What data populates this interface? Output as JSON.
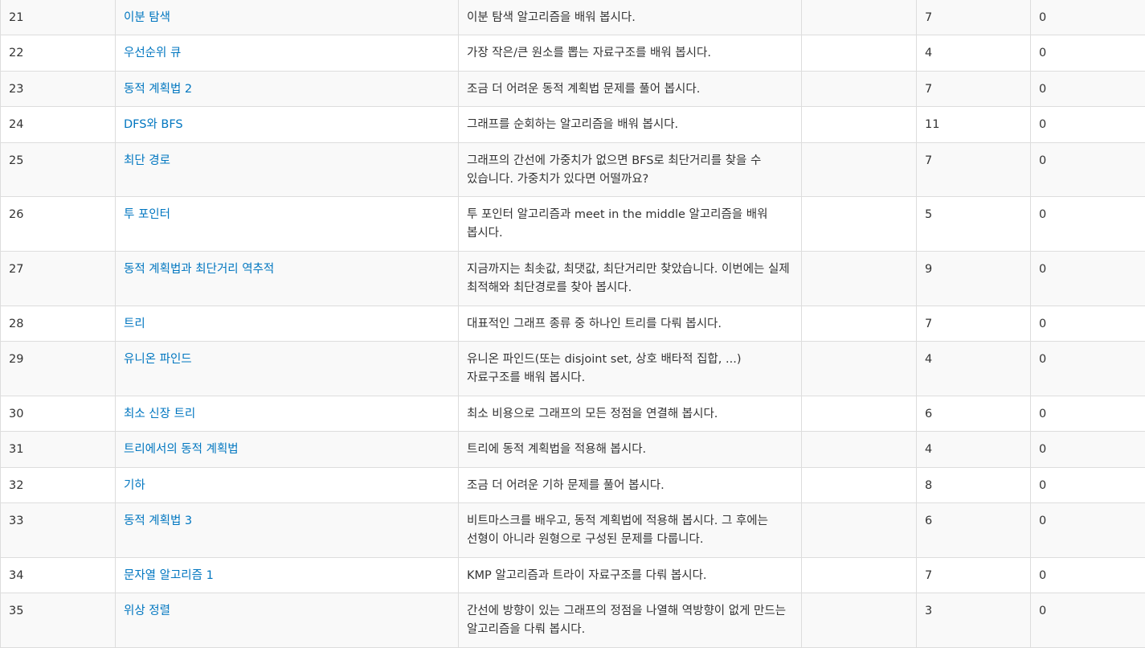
{
  "colors": {
    "link": "#0076c0",
    "text": "#333333",
    "border": "#dddddd",
    "stripe": "#f9f9f9"
  },
  "rows": [
    {
      "no": "21",
      "title": "이분 탐색",
      "desc": "이분 탐색 알고리즘을 배워 봅시다.",
      "extra": "",
      "problems": "7",
      "solved": "0"
    },
    {
      "no": "22",
      "title": "우선순위 큐",
      "desc": "가장 작은/큰 원소를 뽑는 자료구조를 배워 봅시다.",
      "extra": "",
      "problems": "4",
      "solved": "0"
    },
    {
      "no": "23",
      "title": "동적 계획법 2",
      "desc": "조금 더 어려운 동적 계획법 문제를 풀어 봅시다.",
      "extra": "",
      "problems": "7",
      "solved": "0"
    },
    {
      "no": "24",
      "title": "DFS와 BFS",
      "desc": "그래프를 순회하는 알고리즘을 배워 봅시다.",
      "extra": "",
      "problems": "11",
      "solved": "0"
    },
    {
      "no": "25",
      "title": "최단 경로",
      "desc": "그래프의 간선에 가중치가 없으면 BFS로 최단거리를 찾을 수 있습니다. 가중치가 있다면 어떨까요?",
      "extra": "",
      "problems": "7",
      "solved": "0"
    },
    {
      "no": "26",
      "title": "투 포인터",
      "desc": "투 포인터 알고리즘과 meet in the middle 알고리즘을 배워 봅시다.",
      "extra": "",
      "problems": "5",
      "solved": "0"
    },
    {
      "no": "27",
      "title": "동적 계획법과 최단거리 역추적",
      "desc": "지금까지는 최솟값, 최댓값, 최단거리만 찾았습니다. 이번에는 실제 최적해와 최단경로를 찾아 봅시다.",
      "extra": "",
      "problems": "9",
      "solved": "0"
    },
    {
      "no": "28",
      "title": "트리",
      "desc": "대표적인 그래프 종류 중 하나인 트리를 다뤄 봅시다.",
      "extra": "",
      "problems": "7",
      "solved": "0"
    },
    {
      "no": "29",
      "title": "유니온 파인드",
      "desc": "유니온 파인드(또는 disjoint set, 상호 배타적 집합, ...) 자료구조를 배워 봅시다.",
      "extra": "",
      "problems": "4",
      "solved": "0"
    },
    {
      "no": "30",
      "title": "최소 신장 트리",
      "desc": "최소 비용으로 그래프의 모든 정점을 연결해 봅시다.",
      "extra": "",
      "problems": "6",
      "solved": "0"
    },
    {
      "no": "31",
      "title": "트리에서의 동적 계획법",
      "desc": "트리에 동적 계획법을 적용해 봅시다.",
      "extra": "",
      "problems": "4",
      "solved": "0"
    },
    {
      "no": "32",
      "title": "기하",
      "desc": "조금 더 어려운 기하 문제를 풀어 봅시다.",
      "extra": "",
      "problems": "8",
      "solved": "0"
    },
    {
      "no": "33",
      "title": "동적 계획법 3",
      "desc": "비트마스크를 배우고, 동적 계획법에 적용해 봅시다. 그 후에는 선형이 아니라 원형으로 구성된 문제를 다룹니다.",
      "extra": "",
      "problems": "6",
      "solved": "0"
    },
    {
      "no": "34",
      "title": "문자열 알고리즘 1",
      "desc": "KMP 알고리즘과 트라이 자료구조를 다뤄 봅시다.",
      "extra": "",
      "problems": "7",
      "solved": "0"
    },
    {
      "no": "35",
      "title": "위상 정렬",
      "desc": "간선에 방향이 있는 그래프의 정점을 나열해 역방향이 없게 만드는 알고리즘을 다뤄 봅시다.",
      "extra": "",
      "problems": "3",
      "solved": "0"
    }
  ]
}
